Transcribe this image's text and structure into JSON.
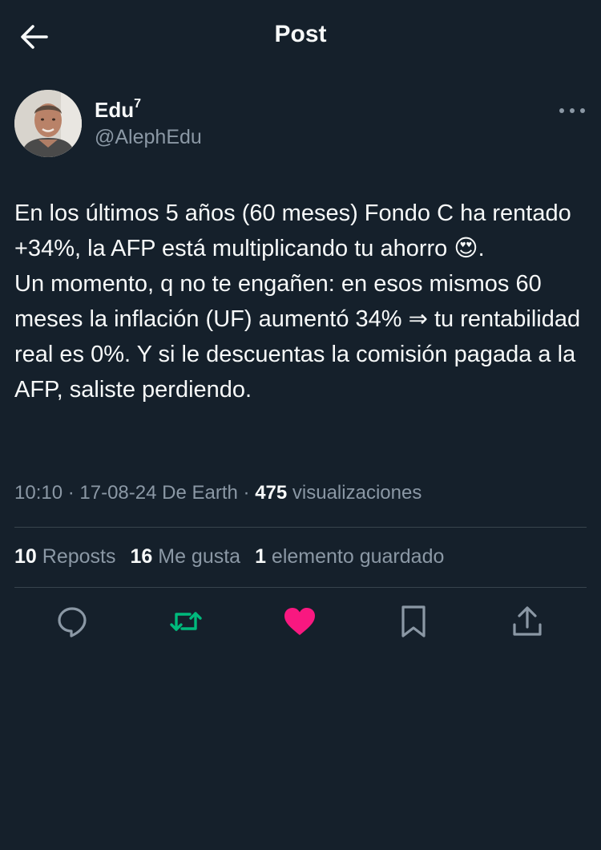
{
  "header": {
    "title": "Post",
    "back_icon": "arrow-left-icon"
  },
  "author": {
    "name": "Edu",
    "name_sup": "7",
    "handle": "@AlephEdu"
  },
  "post": {
    "text": "En los últimos 5 años (60 meses) Fondo C ha rentado +34%, la AFP está multiplicando tu ahorro 😍.\nUn momento, q no te engañen: en esos mismos 60 meses la inflación (UF) aumentó 34% ⇒ tu rentabilidad real es 0%. Y si le descuentas la comisión pagada a la AFP, saliste perdiendo."
  },
  "meta": {
    "time": "10:10",
    "sep1": " · ",
    "date": "17-08-24",
    "source": " De Earth",
    "sep2": " · ",
    "views_count": "475",
    "views_label": " visualizaciones"
  },
  "stats": {
    "reposts_count": "10",
    "reposts_label": " Reposts",
    "likes_count": "16",
    "likes_label": " Me gusta",
    "bookmarks_count": "1",
    "bookmarks_label": " elemento guardado"
  },
  "actions": {
    "reply_icon": "reply-icon",
    "repost_icon": "repost-icon",
    "like_icon": "heart-icon",
    "bookmark_icon": "bookmark-icon",
    "share_icon": "share-icon"
  },
  "colors": {
    "background": "#15202b",
    "text_primary": "#f7f9f9",
    "text_secondary": "#8b98a5",
    "divider": "#38444d",
    "repost_green": "#00ba7c",
    "like_pink": "#f91880"
  }
}
